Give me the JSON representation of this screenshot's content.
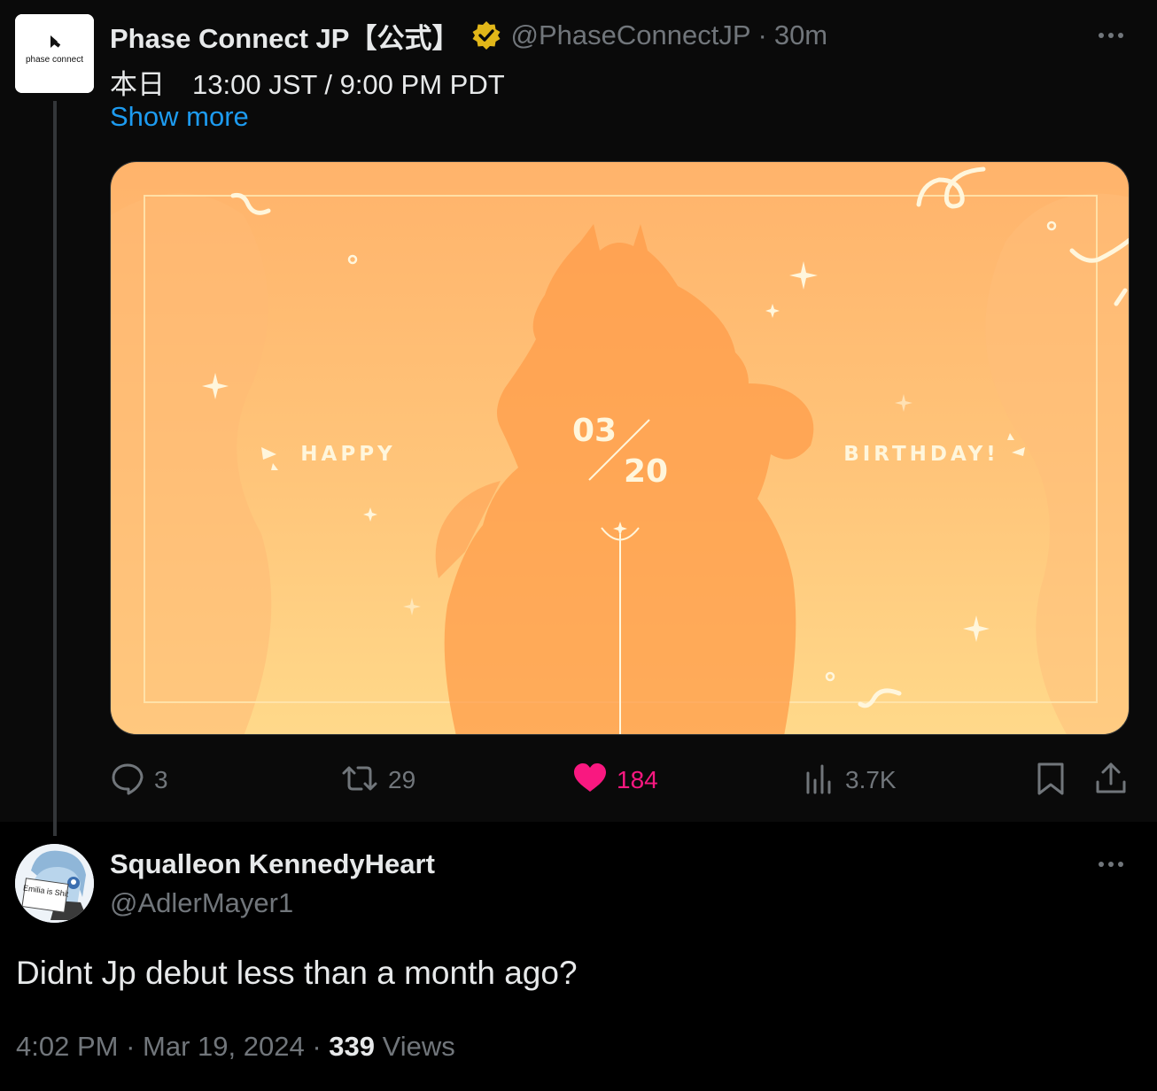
{
  "top_post": {
    "author_name": "Phase Connect JP【公式】",
    "handle": "@PhaseConnectJP",
    "separator": "·",
    "time": "30m",
    "avatar_logo_text": "phase connect",
    "text": "本日　13:00 JST / 9:00 PM PDT",
    "show_more": "Show more",
    "media": {
      "left_text": "HAPPY",
      "right_text": "BIRTHDAY!",
      "month": "03",
      "day": "20"
    },
    "stats": {
      "replies": "3",
      "reposts": "29",
      "likes": "184",
      "views": "3.7K"
    },
    "colors": {
      "like": "#f91880",
      "link": "#1d9bf0",
      "verified": "#e2b719"
    }
  },
  "reply": {
    "author_name": "Squalleon KennedyHeart",
    "handle": "@AdlerMayer1",
    "avatar_sign_text": "Emilia is Shit",
    "text": "Didnt Jp debut less than a month ago?",
    "time": "4:02 PM",
    "date": "Mar 19, 2024",
    "separator": "·",
    "views_count": "339",
    "views_label": "Views"
  }
}
